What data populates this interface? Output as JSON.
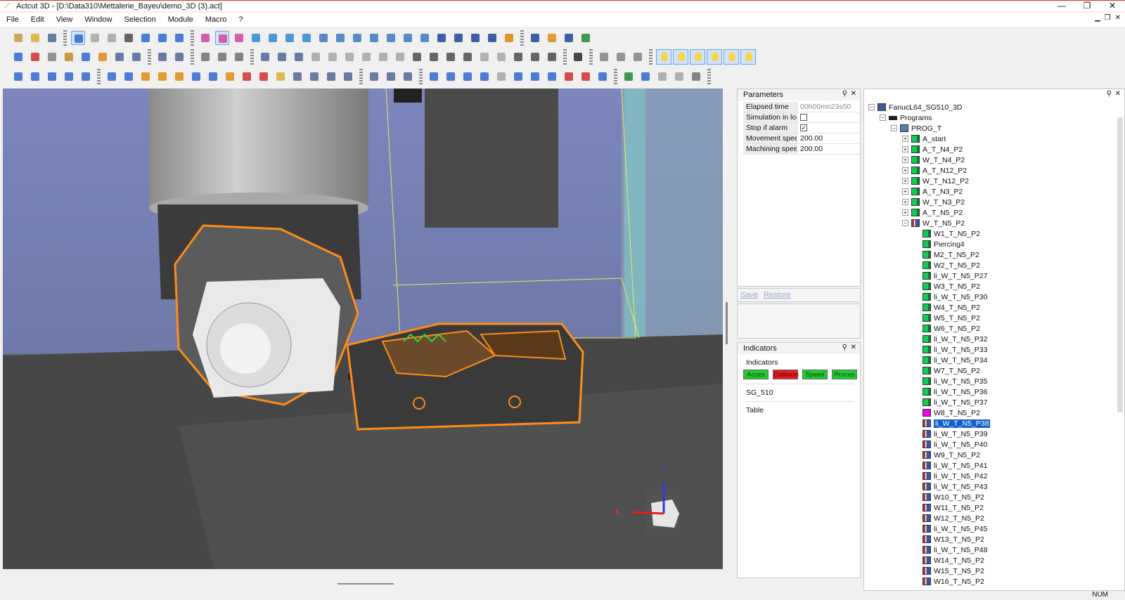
{
  "window": {
    "title": "Actcut 3D - [D:\\Data310\\Mettalerie_Bayeu\\demo_3D (3).act]",
    "controls": [
      "—",
      "❐",
      "✕"
    ]
  },
  "menu": [
    "File",
    "Edit",
    "View",
    "Window",
    "Selection",
    "Module",
    "Macro",
    "?"
  ],
  "parameters": {
    "title": "Parameters",
    "rows": [
      {
        "label": "Elapsed time",
        "value": "00h00mn23s50",
        "type": "text",
        "dim": true
      },
      {
        "label": "Simulation in loo",
        "value": "",
        "type": "checkbox",
        "checked": false
      },
      {
        "label": "Stop if alarm",
        "value": "",
        "type": "checkbox",
        "checked": true
      },
      {
        "label": "Movement speec",
        "value": "200.00",
        "type": "text"
      },
      {
        "label": "Machining speec",
        "value": "200.00",
        "type": "text"
      }
    ],
    "save": "Save",
    "restore": "Restore"
  },
  "indicators": {
    "title": "Indicators",
    "group_label": "Indicators",
    "buttons": [
      {
        "label": "Acces",
        "color": "green"
      },
      {
        "label": "Collision",
        "color": "red"
      },
      {
        "label": "Speed",
        "color": "green"
      },
      {
        "label": "Proces",
        "color": "green"
      }
    ],
    "items": [
      "SG_510",
      "Table"
    ]
  },
  "tree": {
    "nodes": [
      {
        "label": "FanucL64_SG510_3D",
        "depth": 0,
        "exp": "-",
        "icon": "root"
      },
      {
        "label": "Programs",
        "depth": 1,
        "exp": "-",
        "icon": "prog"
      },
      {
        "label": "PROG_T",
        "depth": 2,
        "exp": "-",
        "icon": "folder"
      },
      {
        "label": "A_start",
        "depth": 3,
        "exp": "+",
        "icon": "green"
      },
      {
        "label": "A_T_N4_P2",
        "depth": 3,
        "exp": "+",
        "icon": "green"
      },
      {
        "label": "W_T_N4_P2",
        "depth": 3,
        "exp": "+",
        "icon": "green"
      },
      {
        "label": "A_T_N12_P2",
        "depth": 3,
        "exp": "+",
        "icon": "green"
      },
      {
        "label": "W_T_N12_P2",
        "depth": 3,
        "exp": "+",
        "icon": "green"
      },
      {
        "label": "A_T_N3_P2",
        "depth": 3,
        "exp": "+",
        "icon": "green"
      },
      {
        "label": "W_T_N3_P2",
        "depth": 3,
        "exp": "+",
        "icon": "green"
      },
      {
        "label": "A_T_N5_P2",
        "depth": 3,
        "exp": "+",
        "icon": "green"
      },
      {
        "label": "W_T_N5_P2",
        "depth": 3,
        "exp": "-",
        "icon": "stripe"
      },
      {
        "label": "W1_T_N5_P2",
        "depth": 4,
        "icon": "green"
      },
      {
        "label": "Piercing4",
        "depth": 4,
        "icon": "green"
      },
      {
        "label": "M2_T_N5_P2",
        "depth": 4,
        "icon": "green"
      },
      {
        "label": "W2_T_N5_P2",
        "depth": 4,
        "icon": "green"
      },
      {
        "label": "li_W_T_N5_P27",
        "depth": 4,
        "icon": "green"
      },
      {
        "label": "W3_T_N5_P2",
        "depth": 4,
        "icon": "green"
      },
      {
        "label": "li_W_T_N5_P30",
        "depth": 4,
        "icon": "green"
      },
      {
        "label": "W4_T_N5_P2",
        "depth": 4,
        "icon": "green"
      },
      {
        "label": "W5_T_N5_P2",
        "depth": 4,
        "icon": "green"
      },
      {
        "label": "W6_T_N5_P2",
        "depth": 4,
        "icon": "green"
      },
      {
        "label": "li_W_T_N5_P32",
        "depth": 4,
        "icon": "green"
      },
      {
        "label": "li_W_T_N5_P33",
        "depth": 4,
        "icon": "green"
      },
      {
        "label": "li_W_T_N5_P34",
        "depth": 4,
        "icon": "green"
      },
      {
        "label": "W7_T_N5_P2",
        "depth": 4,
        "icon": "green"
      },
      {
        "label": "li_W_T_N5_P35",
        "depth": 4,
        "icon": "green"
      },
      {
        "label": "li_W_T_N5_P36",
        "depth": 4,
        "icon": "green"
      },
      {
        "label": "li_W_T_N5_P37",
        "depth": 4,
        "icon": "green"
      },
      {
        "label": "W8_T_N5_P2",
        "depth": 4,
        "icon": "magenta"
      },
      {
        "label": "li_W_T_N5_P38",
        "depth": 4,
        "icon": "stripe",
        "selected": true
      },
      {
        "label": "li_W_T_N5_P39",
        "depth": 4,
        "icon": "stripe"
      },
      {
        "label": "li_W_T_N5_P40",
        "depth": 4,
        "icon": "stripe"
      },
      {
        "label": "W9_T_N5_P2",
        "depth": 4,
        "icon": "stripe"
      },
      {
        "label": "li_W_T_N5_P41",
        "depth": 4,
        "icon": "stripe"
      },
      {
        "label": "li_W_T_N5_P42",
        "depth": 4,
        "icon": "stripe"
      },
      {
        "label": "li_W_T_N5_P43",
        "depth": 4,
        "icon": "stripe"
      },
      {
        "label": "W10_T_N5_P2",
        "depth": 4,
        "icon": "stripe"
      },
      {
        "label": "W11_T_N5_P2",
        "depth": 4,
        "icon": "stripe"
      },
      {
        "label": "W12_T_N5_P2",
        "depth": 4,
        "icon": "stripe"
      },
      {
        "label": "li_W_T_N5_P45",
        "depth": 4,
        "icon": "stripe"
      },
      {
        "label": "W13_T_N5_P2",
        "depth": 4,
        "icon": "stripe"
      },
      {
        "label": "li_W_T_N5_P48",
        "depth": 4,
        "icon": "stripe"
      },
      {
        "label": "W14_T_N5_P2",
        "depth": 4,
        "icon": "stripe"
      },
      {
        "label": "W15_T_N5_P2",
        "depth": 4,
        "icon": "stripe"
      },
      {
        "label": "W16_T_N5_P2",
        "depth": 4,
        "icon": "stripe"
      }
    ]
  },
  "axes": {
    "z": "Z",
    "x": "X"
  },
  "status": {
    "num": "NUM"
  }
}
